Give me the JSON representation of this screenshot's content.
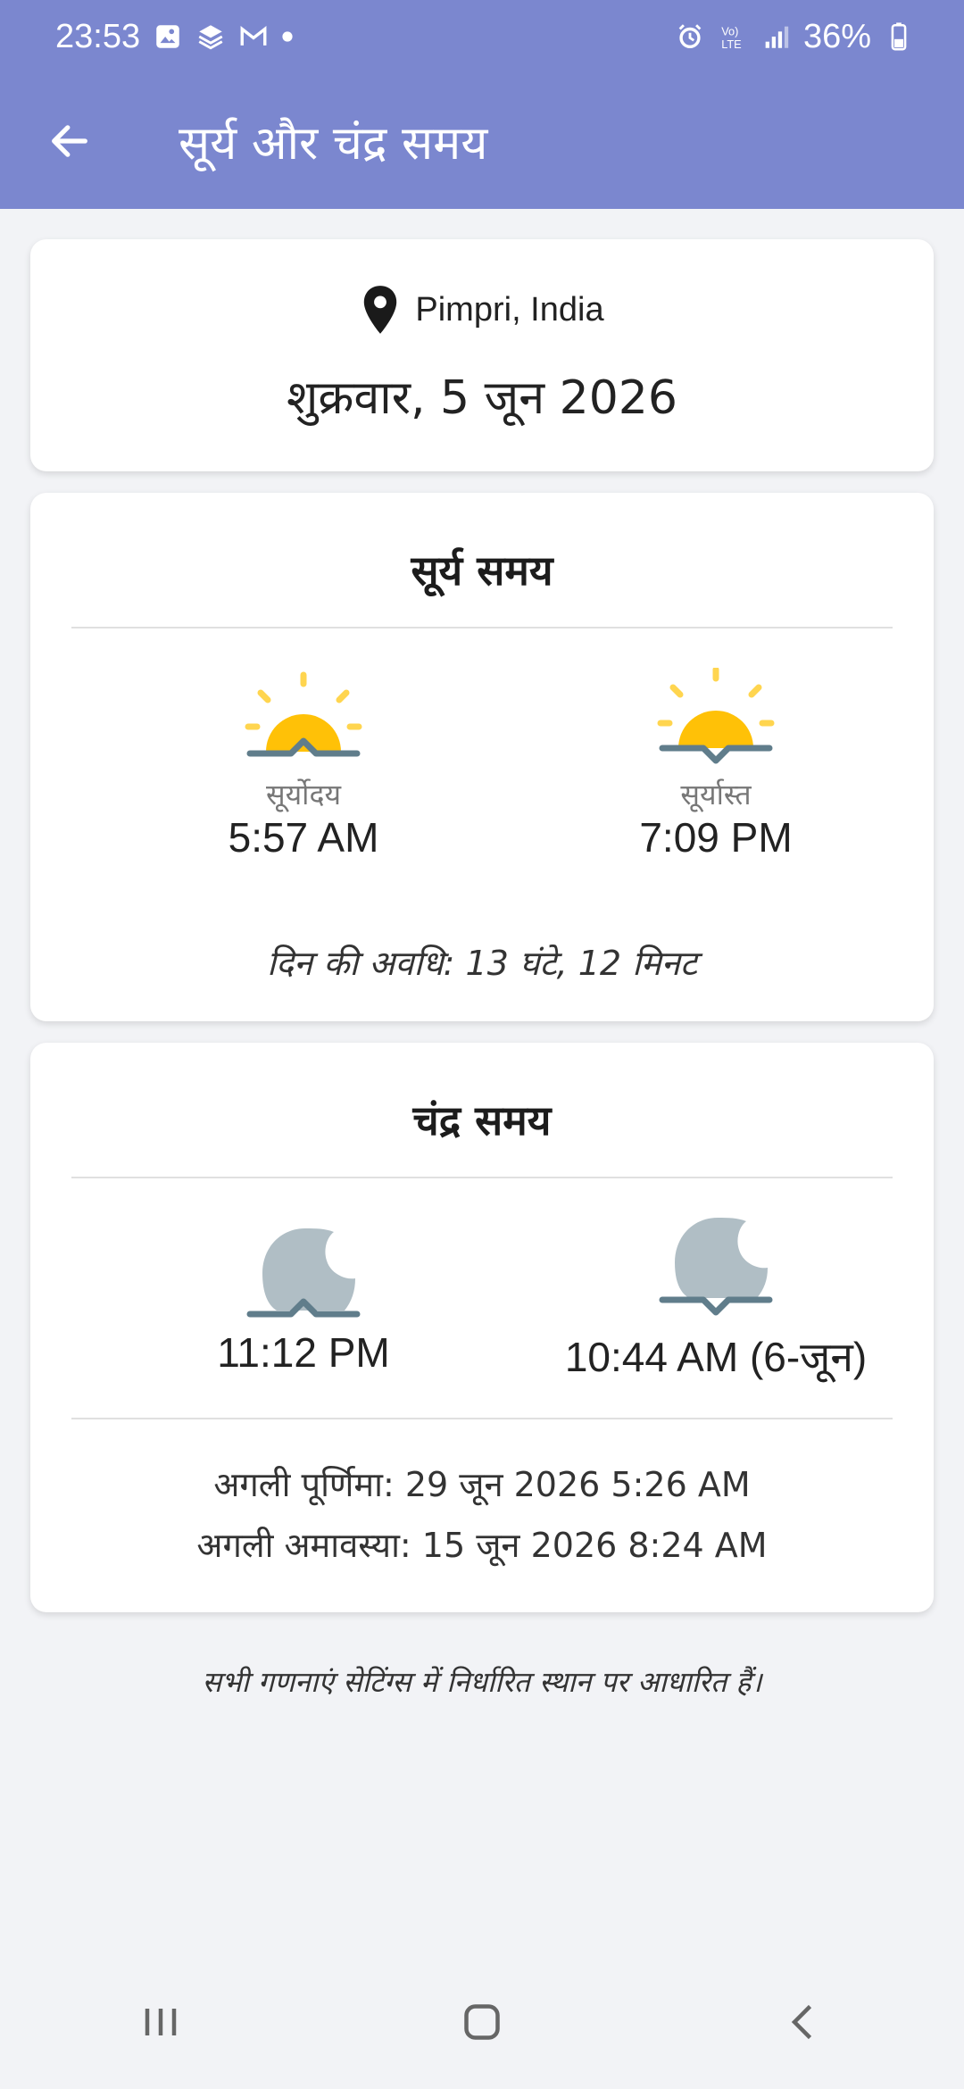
{
  "status_bar": {
    "time": "23:53",
    "battery": "36%",
    "icons_left": [
      "gallery-icon",
      "stack-icon",
      "gmail-icon",
      "dot-icon"
    ],
    "icons_right": [
      "alarm-icon",
      "volte-icon",
      "signal-icon",
      "battery-icon"
    ]
  },
  "app_bar": {
    "title": "सूर्य और चंद्र समय",
    "back_icon": "arrow-left-icon"
  },
  "location_card": {
    "location": "Pimpri, India",
    "date": "शुक्रवार, 5 जून 2026",
    "pin_icon": "location-pin-icon"
  },
  "sun_card": {
    "title": "सूर्य समय",
    "sunrise_label": "सूर्योदय",
    "sunrise_time": "5:57 AM",
    "sunset_label": "सूर्यास्त",
    "sunset_time": "7:09 PM",
    "day_length": "दिन की अवधि: 13 घंटे, 12 मिनट",
    "sun_color": "#ffc107",
    "horizon_color": "#607d8b"
  },
  "moon_card": {
    "title": "चंद्र समय",
    "moonrise_time": "11:12 PM",
    "moonset_time": "10:44 AM (6-जून)",
    "next_full_moon": "अगली पूर्णिमा: 29 जून 2026 5:26 AM",
    "next_new_moon": "अगली अमावस्या: 15 जून 2026 8:24 AM",
    "moon_color": "#b0bec5"
  },
  "footnote": "सभी गणनाएं सेटिंग्स में निर्धारित स्थान पर आधारित हैं।",
  "nav_bar": {
    "icons": [
      "recent-apps-icon",
      "home-icon",
      "back-nav-icon"
    ]
  },
  "colors": {
    "primary": "#7b87cf",
    "background": "#f2f3f6"
  }
}
